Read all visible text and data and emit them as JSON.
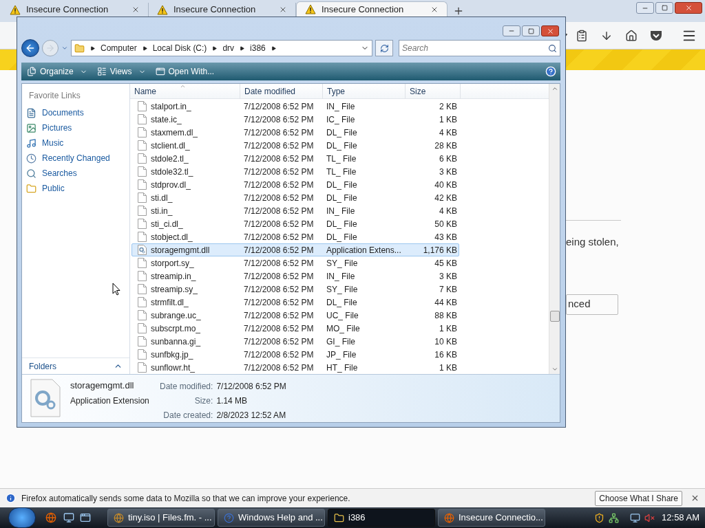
{
  "browser": {
    "tabs": [
      {
        "label": "Insecure Connection",
        "selected": false
      },
      {
        "label": "Insecure Connection",
        "selected": false
      },
      {
        "label": "Insecure Connection",
        "selected": true
      }
    ],
    "page": {
      "text_fragment": "eing stolen,",
      "button_fragment": "nced"
    },
    "notification": {
      "text": "Firefox automatically sends some data to Mozilla so that we can improve your experience.",
      "button": "Choose What I Share"
    }
  },
  "explorer": {
    "address": [
      "Computer",
      "Local Disk (C:)",
      "drv",
      "i386"
    ],
    "search": {
      "placeholder": "Search"
    },
    "toolbar": [
      {
        "label": "Organize",
        "kind": "organize",
        "has_menu": true
      },
      {
        "label": "Views",
        "kind": "views",
        "has_menu": true
      },
      {
        "label": "Open With...",
        "kind": "open",
        "has_menu": false
      }
    ],
    "sidebar": {
      "heading": "Favorite Links",
      "items": [
        {
          "label": "Documents",
          "kind": "documents"
        },
        {
          "label": "Pictures",
          "kind": "pictures"
        },
        {
          "label": "Music",
          "kind": "music"
        },
        {
          "label": "Recently Changed",
          "kind": "recent"
        },
        {
          "label": "Searches",
          "kind": "searches"
        },
        {
          "label": "Public",
          "kind": "public"
        }
      ],
      "footer": "Folders"
    },
    "columns": [
      {
        "label": "Name",
        "sorted": true
      },
      {
        "label": "Date modified",
        "sorted": false
      },
      {
        "label": "Type",
        "sorted": false
      },
      {
        "label": "Size",
        "sorted": false
      }
    ],
    "rows": [
      {
        "name": "stalport.in_",
        "date": "7/12/2008 6:52 PM",
        "type": "IN_ File",
        "size": "2 KB",
        "kind": "file",
        "selected": false
      },
      {
        "name": "state.ic_",
        "date": "7/12/2008 6:52 PM",
        "type": "IC_ File",
        "size": "1 KB",
        "kind": "file",
        "selected": false
      },
      {
        "name": "staxmem.dl_",
        "date": "7/12/2008 6:52 PM",
        "type": "DL_ File",
        "size": "4 KB",
        "kind": "file",
        "selected": false
      },
      {
        "name": "stclient.dl_",
        "date": "7/12/2008 6:52 PM",
        "type": "DL_ File",
        "size": "28 KB",
        "kind": "file",
        "selected": false
      },
      {
        "name": "stdole2.tl_",
        "date": "7/12/2008 6:52 PM",
        "type": "TL_ File",
        "size": "6 KB",
        "kind": "file",
        "selected": false
      },
      {
        "name": "stdole32.tl_",
        "date": "7/12/2008 6:52 PM",
        "type": "TL_ File",
        "size": "3 KB",
        "kind": "file",
        "selected": false
      },
      {
        "name": "stdprov.dl_",
        "date": "7/12/2008 6:52 PM",
        "type": "DL_ File",
        "size": "40 KB",
        "kind": "file",
        "selected": false
      },
      {
        "name": "sti.dl_",
        "date": "7/12/2008 6:52 PM",
        "type": "DL_ File",
        "size": "42 KB",
        "kind": "file",
        "selected": false
      },
      {
        "name": "sti.in_",
        "date": "7/12/2008 6:52 PM",
        "type": "IN_ File",
        "size": "4 KB",
        "kind": "file",
        "selected": false
      },
      {
        "name": "sti_ci.dl_",
        "date": "7/12/2008 6:52 PM",
        "type": "DL_ File",
        "size": "50 KB",
        "kind": "file",
        "selected": false
      },
      {
        "name": "stobject.dl_",
        "date": "7/12/2008 6:52 PM",
        "type": "DL_ File",
        "size": "43 KB",
        "kind": "file",
        "selected": false
      },
      {
        "name": "storagemgmt.dll",
        "date": "7/12/2008 6:52 PM",
        "type": "Application Extens...",
        "size": "1,176 KB",
        "kind": "dll",
        "selected": true
      },
      {
        "name": "storport.sy_",
        "date": "7/12/2008 6:52 PM",
        "type": "SY_ File",
        "size": "45 KB",
        "kind": "file",
        "selected": false
      },
      {
        "name": "streamip.in_",
        "date": "7/12/2008 6:52 PM",
        "type": "IN_ File",
        "size": "3 KB",
        "kind": "file",
        "selected": false
      },
      {
        "name": "streamip.sy_",
        "date": "7/12/2008 6:52 PM",
        "type": "SY_ File",
        "size": "7 KB",
        "kind": "file",
        "selected": false
      },
      {
        "name": "strmfilt.dl_",
        "date": "7/12/2008 6:52 PM",
        "type": "DL_ File",
        "size": "44 KB",
        "kind": "file",
        "selected": false
      },
      {
        "name": "subrange.uc_",
        "date": "7/12/2008 6:52 PM",
        "type": "UC_ File",
        "size": "88 KB",
        "kind": "file",
        "selected": false
      },
      {
        "name": "subscrpt.mo_",
        "date": "7/12/2008 6:52 PM",
        "type": "MO_ File",
        "size": "1 KB",
        "kind": "file",
        "selected": false
      },
      {
        "name": "sunbanna.gi_",
        "date": "7/12/2008 6:52 PM",
        "type": "GI_ File",
        "size": "10 KB",
        "kind": "file",
        "selected": false
      },
      {
        "name": "sunfbkg.jp_",
        "date": "7/12/2008 6:52 PM",
        "type": "JP_ File",
        "size": "16 KB",
        "kind": "file",
        "selected": false
      },
      {
        "name": "sunflowr.ht_",
        "date": "7/12/2008 6:52 PM",
        "type": "HT_ File",
        "size": "1 KB",
        "kind": "file",
        "selected": false
      }
    ],
    "details": {
      "name": "storagemgmt.dll",
      "type": "Application Extension",
      "fields": [
        {
          "label": "Date modified:",
          "value": "7/12/2008 6:52 PM"
        },
        {
          "label": "Size:",
          "value": "1.14 MB"
        },
        {
          "label": "Date created:",
          "value": "2/8/2023 12:52 AM"
        }
      ]
    }
  },
  "taskbar": {
    "buttons": [
      {
        "label": "tiny.iso | Files.fm. - ...",
        "kind": "web",
        "selected": false
      },
      {
        "label": "Windows Help and ...",
        "kind": "help",
        "selected": false
      },
      {
        "label": "i386",
        "kind": "folder",
        "selected": true
      },
      {
        "label": "Insecure Connectio...",
        "kind": "browser",
        "selected": false
      }
    ],
    "clock": "12:58 AM"
  }
}
